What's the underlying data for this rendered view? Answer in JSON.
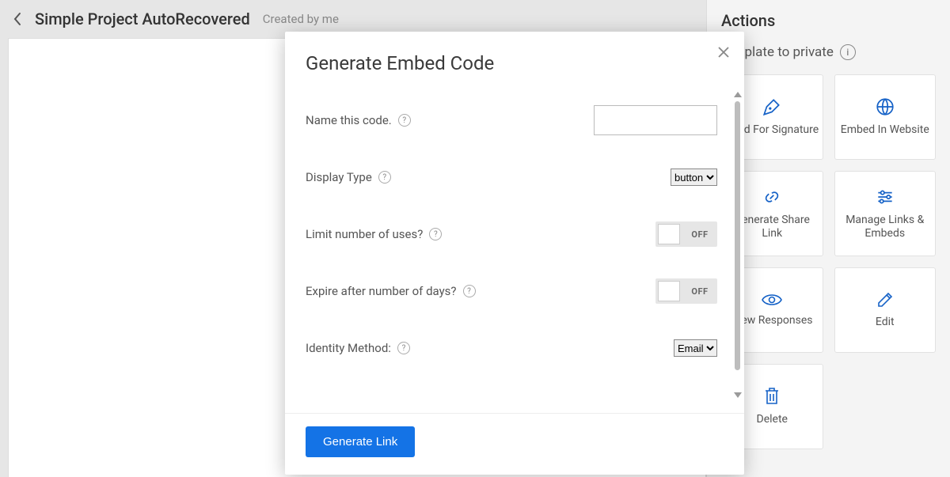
{
  "header": {
    "title": "Simple Project AutoRecovered",
    "created_by": "Created by me"
  },
  "actions": {
    "title": "Actions",
    "private_text": "template to private",
    "cards": [
      {
        "label": "Send For Signature"
      },
      {
        "label": "Embed In Website"
      },
      {
        "label": "Generate Share Link"
      },
      {
        "label": "Manage Links & Embeds"
      },
      {
        "label": "View Responses"
      },
      {
        "label": "Edit"
      },
      {
        "label": "Delete"
      }
    ]
  },
  "modal": {
    "title": "Generate Embed Code",
    "fields": {
      "name_label": "Name this code.",
      "display_type_label": "Display Type",
      "display_type_options": [
        "button"
      ],
      "display_type_value": "button",
      "limit_uses_label": "Limit number of uses?",
      "limit_uses_state": "OFF",
      "expire_days_label": "Expire after number of days?",
      "expire_days_state": "OFF",
      "identity_label": "Identity Method:",
      "identity_options": [
        "Email"
      ],
      "identity_value": "Email"
    },
    "footer": {
      "primary": "Generate Link"
    }
  }
}
